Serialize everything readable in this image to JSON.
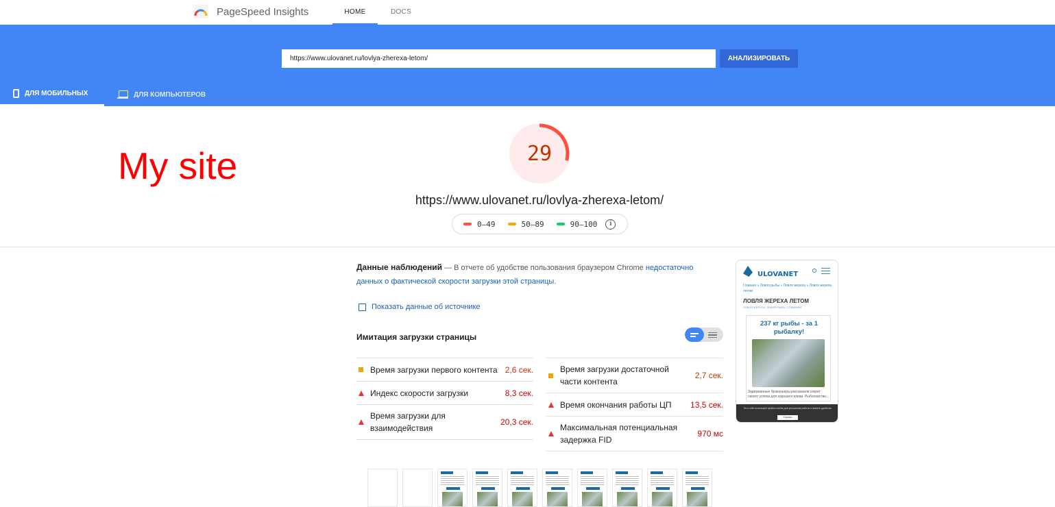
{
  "app": {
    "title": "PageSpeed Insights",
    "logo_icon": "pagespeed-gauge-logo"
  },
  "nav": {
    "home": "HOME",
    "docs": "DOCS"
  },
  "search": {
    "url": "https://www.ulovanet.ru/lovlya-zherexa-letom/",
    "button": "АНАЛИЗИРОВАТЬ"
  },
  "device_tabs": {
    "mobile": "ДЛЯ МОБИЛЬНЫХ",
    "desktop": "ДЛЯ КОМПЬЮТЕРОВ",
    "active": "mobile"
  },
  "annotation": "My site",
  "score": {
    "value": "29",
    "fraction": 0.29,
    "color": "#ff4e42",
    "bg": "#fdeceb"
  },
  "tested_url": "https://www.ulovanet.ru/lovlya-zherexa-letom/",
  "legend": [
    {
      "label": "0–49",
      "color": "#ff4e42"
    },
    {
      "label": "50–89",
      "color": "#ffa400"
    },
    {
      "label": "90–100",
      "color": "#0cce6b"
    }
  ],
  "field_data": {
    "title": "Данные наблюдений",
    "text": " — В отчете об удобстве пользования браузером Chrome ",
    "link": "недостаточно данных о фактической скорости загрузки этой страницы.",
    "origin_label": "Показать данные об источнике"
  },
  "lab_data": {
    "title": "Имитация загрузки страницы",
    "left": [
      {
        "icon": "orange-square-icon",
        "label": "Время загрузки первого контента",
        "value": "2,6 сек.",
        "status": "average"
      },
      {
        "icon": "red-triangle-icon",
        "label": "Индекс скорости загрузки",
        "value": "8,3 сек.",
        "status": "fail"
      },
      {
        "icon": "red-triangle-icon",
        "label": "Время загрузки для взаимодействия",
        "value": "20,3 сек.",
        "status": "fail"
      }
    ],
    "right": [
      {
        "icon": "orange-square-icon",
        "label": "Время загрузки достаточной части контента",
        "value": "2,7 сек.",
        "status": "average"
      },
      {
        "icon": "red-triangle-icon",
        "label": "Время окончания работы ЦП",
        "value": "13,5 сек.",
        "status": "fail"
      },
      {
        "icon": "red-triangle-icon",
        "label": "Максимальная потенциальная задержка FID",
        "value": "970 мс",
        "status": "fail"
      }
    ]
  },
  "phone_preview": {
    "brand": "ULOVANET",
    "breadcrumb": "Главная » Ловля рыбы » Ловля жереха » Ловля жереха летом",
    "heading": "ЛОВЛЯ ЖЕРЕХА ЛЕТОМ",
    "tags": "ЛОВЛЯ ЖЕРЕХА, ЛОВЛЯ РЫБЫ, СПИННИНГ",
    "card_title": "237 кг рыбы - за 1 рыбалку!",
    "card_text": "Задержанные браконьеры рассказали секрет своего успеха для хорошего клева. Рыболовство...",
    "cookie_text": "Этот сайт использует файлы cookie для улучшения работы и вашего удобства.",
    "cookie_button": "Хорошо"
  },
  "filmstrip": {
    "frames": 10,
    "blank_frames": 2
  }
}
